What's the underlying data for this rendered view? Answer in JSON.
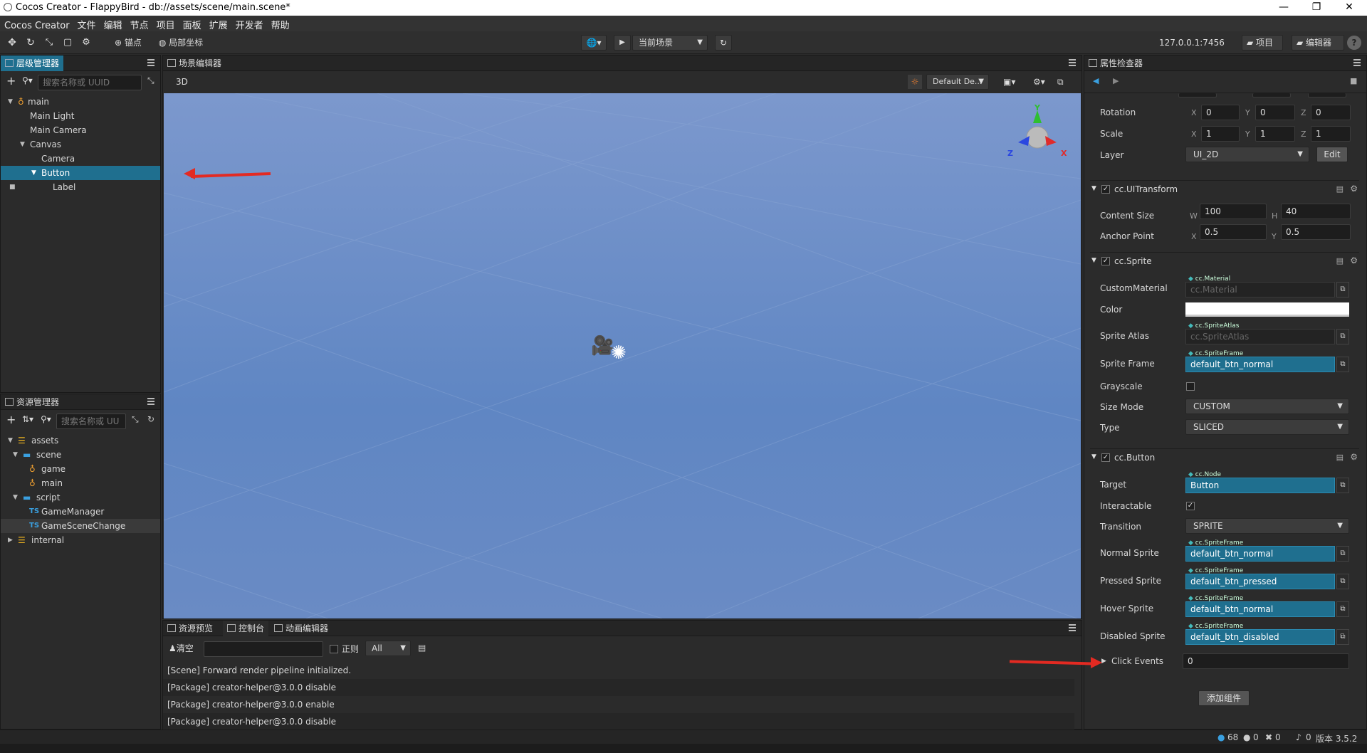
{
  "window": {
    "title": "Cocos Creator - FlappyBird - db://assets/scene/main.scene*",
    "min": "—",
    "max": "❐",
    "close": "✕"
  },
  "menu": [
    "Cocos Creator",
    "文件",
    "编辑",
    "节点",
    "项目",
    "面板",
    "扩展",
    "开发者",
    "帮助"
  ],
  "toolbar": {
    "anchor_label": "锚点",
    "local_label": "局部坐标",
    "scene_select": "当前场景",
    "ip": "127.0.0.1:7456",
    "project_btn": "项目",
    "editor_btn": "编辑器",
    "help": "?"
  },
  "hierarchy": {
    "tab": "层级管理器",
    "search_placeholder": "搜索名称或 UUID",
    "nodes": [
      "main",
      "Main Light",
      "Main Camera",
      "Canvas",
      "Camera",
      "Button",
      "Label"
    ]
  },
  "assets": {
    "tab": "资源管理器",
    "search_placeholder": "搜索名称或 UU",
    "items": [
      "assets",
      "scene",
      "game",
      "main",
      "script",
      "GameManager",
      "GameSceneChange",
      "internal"
    ],
    "ts": "TS"
  },
  "scene_editor": {
    "tab": "场景编辑器",
    "mode": "3D",
    "camera_select": "Default De...",
    "gizmo": {
      "x": "X",
      "y": "Y",
      "z": "Z"
    }
  },
  "console": {
    "tabs": [
      "资源预览",
      "控制台",
      "动画编辑器"
    ],
    "clear_label": "清空",
    "regex_label": "正则",
    "level_select": "All",
    "logs": [
      "[Scene] Forward render pipeline initialized.",
      "[Package] creator-helper@3.0.0 disable",
      "[Package] creator-helper@3.0.0 enable",
      "[Package] creator-helper@3.0.0 disable"
    ]
  },
  "inspector": {
    "tab": "属性检查器",
    "node": {
      "rotation_label": "Rotation",
      "rotation": [
        "0",
        "0",
        "0"
      ],
      "scale_label": "Scale",
      "scale": [
        "1",
        "1",
        "1"
      ],
      "layer_label": "Layer",
      "layer": "UI_2D",
      "edit_btn": "Edit"
    },
    "axes": {
      "x": "X",
      "y": "Y",
      "z": "Z",
      "w": "W",
      "h": "H"
    },
    "uitransform": {
      "title": "cc.UITransform",
      "content_size_label": "Content Size",
      "w": "100",
      "h": "40",
      "anchor_label": "Anchor Point",
      "ax": "0.5",
      "ay": "0.5"
    },
    "sprite": {
      "title": "cc.Sprite",
      "custom_material_label": "CustomMaterial",
      "custom_material_type": "cc.Material",
      "custom_material": "cc.Material",
      "color_label": "Color",
      "color": "#ffffff",
      "atlas_label": "Sprite Atlas",
      "atlas_type": "cc.SpriteAtlas",
      "atlas": "cc.SpriteAtlas",
      "frame_label": "Sprite Frame",
      "frame_type": "cc.SpriteFrame",
      "frame": "default_btn_normal",
      "grayscale_label": "Grayscale",
      "size_mode_label": "Size Mode",
      "size_mode": "CUSTOM",
      "type_label": "Type",
      "type": "SLICED"
    },
    "button": {
      "title": "cc.Button",
      "target_label": "Target",
      "target_type": "cc.Node",
      "target": "Button",
      "interactable_label": "Interactable",
      "transition_label": "Transition",
      "transition": "SPRITE",
      "sprite_type": "cc.SpriteFrame",
      "normal_label": "Normal Sprite",
      "normal": "default_btn_normal",
      "pressed_label": "Pressed Sprite",
      "pressed": "default_btn_pressed",
      "hover_label": "Hover Sprite",
      "hover": "default_btn_normal",
      "disabled_label": "Disabled Sprite",
      "disabled": "default_btn_disabled",
      "click_events_label": "Click Events",
      "click_events": "0"
    },
    "add_component": "添加组件"
  },
  "status": {
    "count_info": "68",
    "warn": "0",
    "error": "0",
    "notify": "0",
    "version": "版本 3.5.2"
  }
}
